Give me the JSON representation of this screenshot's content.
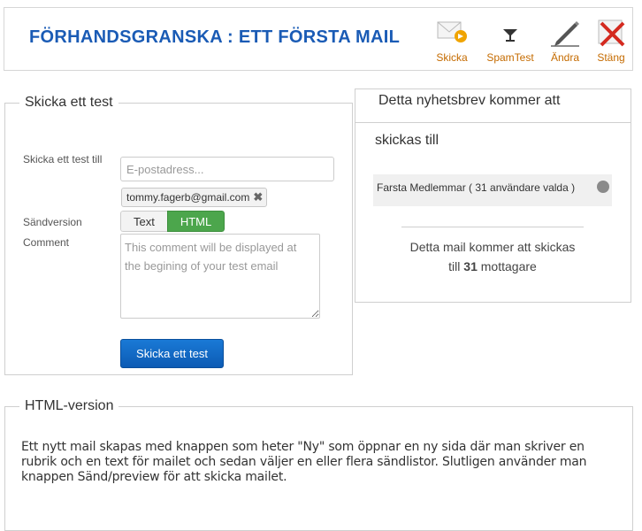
{
  "header": {
    "title": "FÖRHANDSGRANSKA : ETT FÖRSTA MAIL",
    "toolbar": [
      {
        "label": "Skicka",
        "icon": "send-mail-icon"
      },
      {
        "label": "SpamTest",
        "icon": "funnel-icon"
      },
      {
        "label": "Ändra",
        "icon": "pencil-icon"
      },
      {
        "label": "Stäng",
        "icon": "close-icon"
      }
    ]
  },
  "test": {
    "legend": "Skicka ett test",
    "to_label": "Skicka ett test till",
    "email_placeholder": "E-postadress...",
    "recipient_chip": "tommy.fagerb@gmail.com",
    "version_label": "Sändversion",
    "version_options": [
      "Text",
      "HTML"
    ],
    "version_selected": "HTML",
    "comment_label": "Comment",
    "comment_placeholder": "This comment will be displayed at the begining of your test email",
    "send_button": "Skicka ett test"
  },
  "newsletter": {
    "title_line1": "Detta nyhetsbrev kommer att",
    "title_line2": "skickas till",
    "list_item": "Farsta Medlemmar ( 31 användare valda )",
    "summary_prefix": "Detta mail kommer att skickas",
    "summary_to": "till",
    "summary_count": "31",
    "summary_suffix": "mottagare"
  },
  "html_version": {
    "legend": "HTML-version",
    "body": "Ett nytt mail skapas med knappen som heter \"Ny\" som öppnar en ny sida där man skriver en rubrik och en text för mailet och sedan väljer en eller flera sändlistor. Slutligen använder man knappen Sänd/preview för att skicka mailet."
  },
  "colors": {
    "title_blue": "#1a5bb5",
    "toolbar_orange": "#c56b00",
    "send_blue": "#0c5bb4",
    "toggle_green": "#4ca64c"
  }
}
